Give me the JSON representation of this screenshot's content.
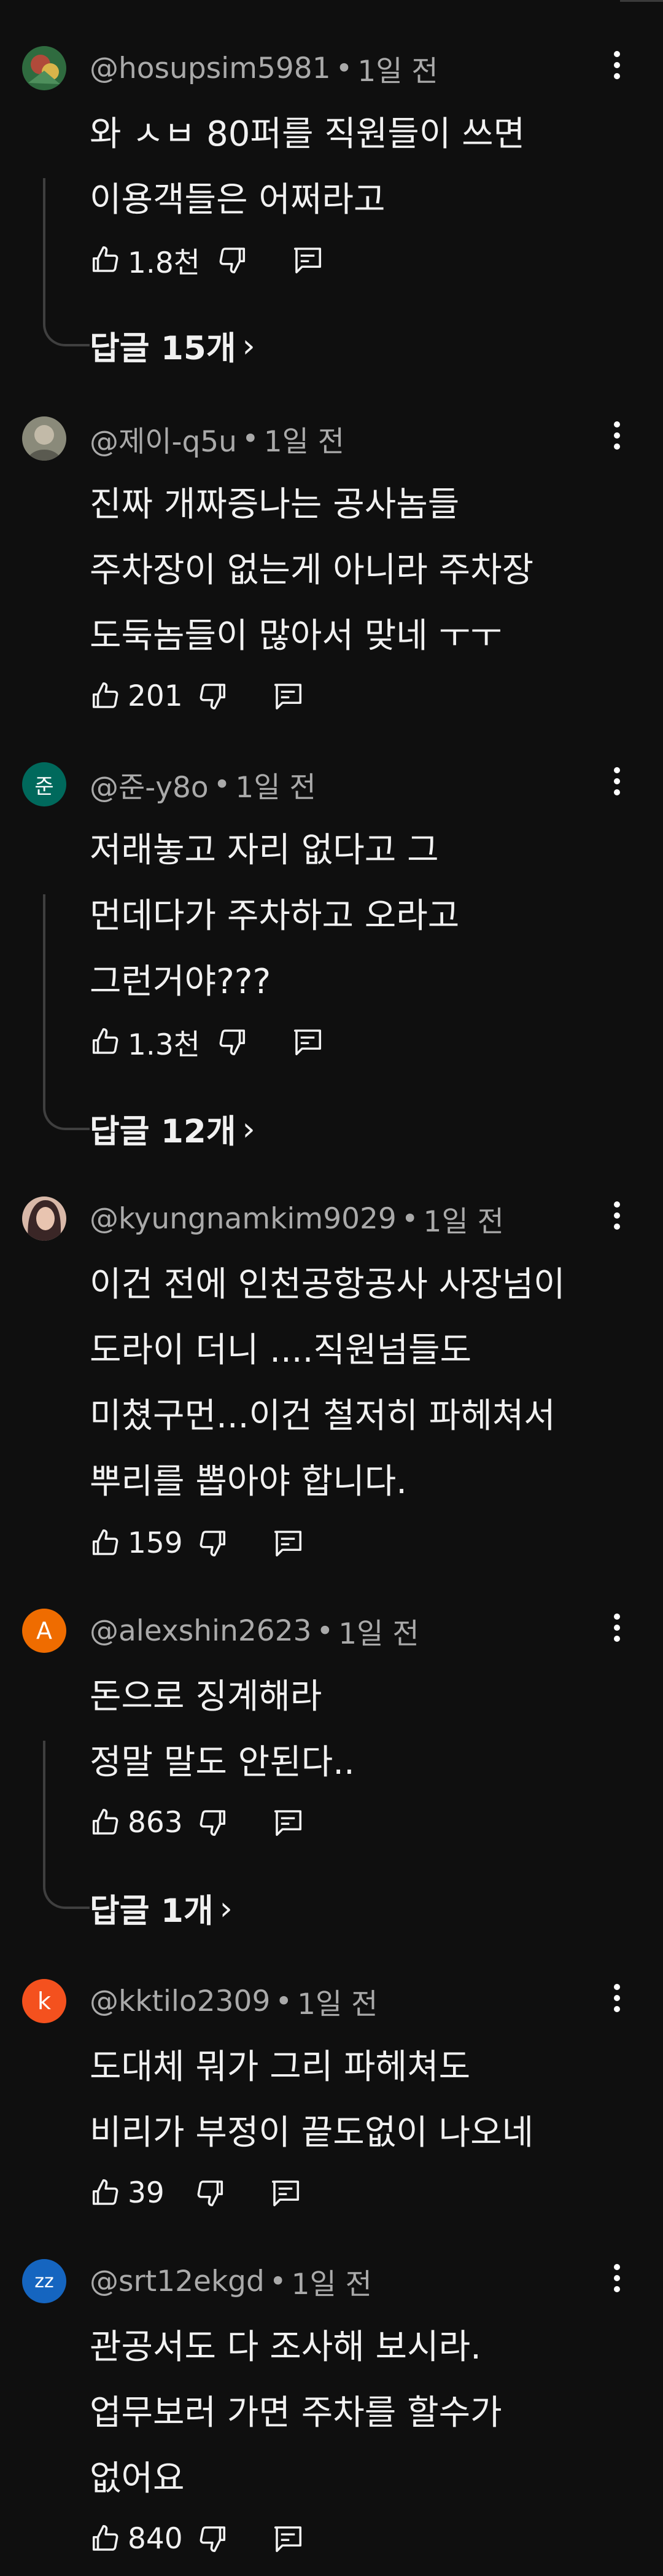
{
  "comments": [
    {
      "handle": "@hosupsim5981",
      "time": "1일 전",
      "lines": [
        "와 ㅅㅂ 80퍼를 직원들이 쓰면",
        "이용객들은 어쩌라고"
      ],
      "likes": "1.8천",
      "replies": "답글 15개",
      "avatar": {
        "type": "image",
        "colors": [
          "#3a7a4a",
          "#b04a3a",
          "#d9b44a"
        ]
      }
    },
    {
      "handle": "@제이-q5u",
      "time": "1일 전",
      "lines": [
        "진짜 개짜증나는 공사놈들",
        "주차장이 없는게 아니라 주차장",
        "도둑놈들이 많아서 맞네 ㅜㅜ"
      ],
      "likes": "201",
      "avatar": {
        "type": "image",
        "colors": [
          "#8a8a7a",
          "#b8b0a0",
          "#5a5a50"
        ]
      }
    },
    {
      "handle": "@준-y8o",
      "time": "1일 전",
      "lines": [
        "저래놓고 자리 없다고 그",
        "먼데다가 주차하고 오라고",
        "그런거야???"
      ],
      "likes": "1.3천",
      "replies": "답글 12개",
      "avatar": {
        "type": "letter",
        "letter": "준",
        "color": "#00695c"
      }
    },
    {
      "handle": "@kyungnamkim9029",
      "time": "1일 전",
      "lines": [
        "이건 전에 인천공항공사 사장넘이",
        "도라이 더니 ....직원넘들도",
        "미쳤구먼...이건 철저히 파헤쳐서",
        "뿌리를 뽑아야 합니다."
      ],
      "likes": "159",
      "avatar": {
        "type": "image",
        "colors": [
          "#c7a08a",
          "#3a2a2a",
          "#e8c4b0"
        ]
      }
    },
    {
      "handle": "@alexshin2623",
      "time": "1일 전",
      "lines": [
        "돈으로 징계해라",
        "정말 말도 안된다.."
      ],
      "likes": "863",
      "replies": "답글 1개",
      "avatar": {
        "type": "letter",
        "letter": "A",
        "color": "#ef6c00"
      }
    },
    {
      "handle": "@kktilo2309",
      "time": "1일 전",
      "lines": [
        "도대체 뭐가 그리 파헤쳐도",
        "비리가 부정이 끝도없이 나오네"
      ],
      "likes": "39",
      "avatar": {
        "type": "letter",
        "letter": "k",
        "color": "#f4511e"
      }
    },
    {
      "handle": "@srt12ekgd",
      "time": "1일 전",
      "lines": [
        "관공서도 다 조사해 보시라.",
        "업무보러 가면 주차를 할수가",
        "없어요"
      ],
      "likes": "840",
      "avatar": {
        "type": "letter",
        "letter": "zz",
        "color": "#1565c0"
      }
    }
  ],
  "icons": {
    "like": "thumbs-up-icon",
    "dislike": "thumbs-down-icon",
    "reply": "comment-reply-icon",
    "more": "more-vert-icon",
    "chevron": "chevron-right-icon"
  },
  "colors": {
    "background": "#0f0f0f",
    "text_primary": "#f1f1f1",
    "text_secondary": "#aaaaaa",
    "thread_line": "#3f3f3f"
  }
}
